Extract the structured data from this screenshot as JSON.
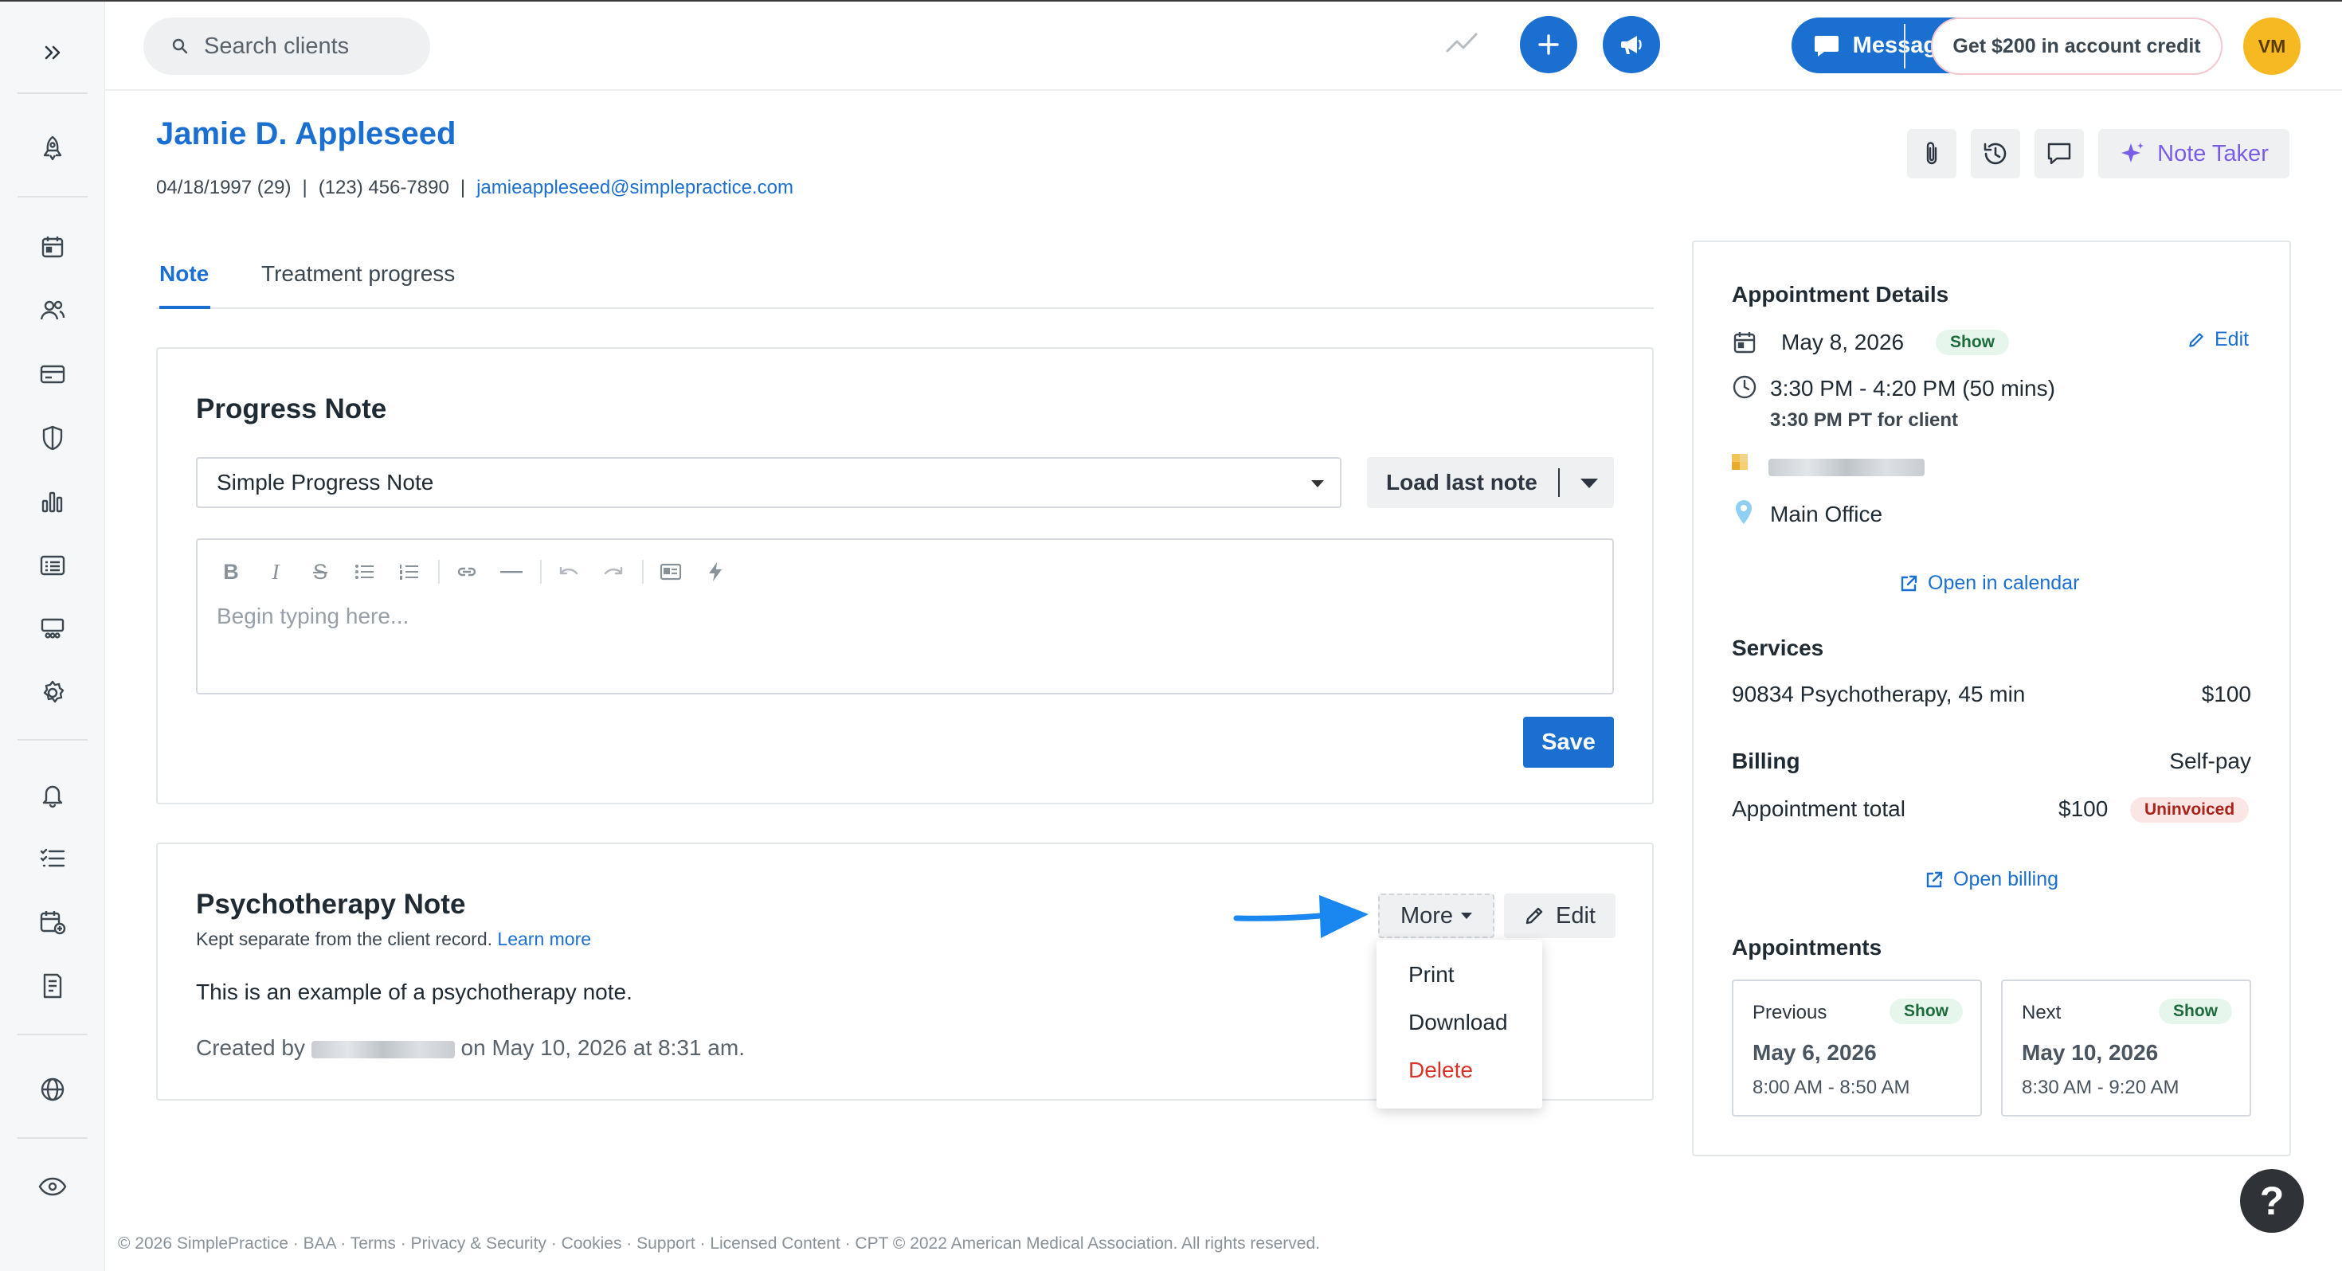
{
  "search": {
    "placeholder": "Search clients"
  },
  "topbar": {
    "messages_label": "Messages",
    "credit_label": "Get $200 in account credit",
    "avatar_initials": "VM"
  },
  "client": {
    "name": "Jamie D. Appleseed",
    "dob": "04/18/1997 (29)",
    "phone": "(123) 456-7890",
    "email": "jamieappleseed@simplepractice.com"
  },
  "header_actions": {
    "note_taker_label": "Note Taker"
  },
  "tabs": [
    {
      "label": "Note",
      "active": true
    },
    {
      "label": "Treatment progress",
      "active": false
    }
  ],
  "progress_note": {
    "title": "Progress Note",
    "template_selected": "Simple Progress Note",
    "load_last_label": "Load last note",
    "editor_placeholder": "Begin typing here...",
    "save_label": "Save"
  },
  "psychotherapy_note": {
    "title": "Psychotherapy Note",
    "subtitle": "Kept separate from the client record.",
    "learn_more": "Learn more",
    "more_label": "More",
    "edit_label": "Edit",
    "body": "This is an example of a psychotherapy note.",
    "created_prefix": "Created by",
    "created_suffix": "on May 10, 2026 at 8:31 am.",
    "menu": [
      "Print",
      "Download",
      "Delete"
    ]
  },
  "appointment": {
    "section_title": "Appointment Details",
    "edit_label": "Edit",
    "date": "May 8, 2026",
    "status": "Show",
    "time": "3:30 PM - 4:20 PM (50 mins)",
    "client_time": "3:30 PM PT for client",
    "location": "Main Office",
    "open_calendar": "Open in calendar",
    "services_title": "Services",
    "service_name": "90834 Psychotherapy, 45 min",
    "service_price": "$100",
    "billing_title": "Billing",
    "billing_type": "Self-pay",
    "total_label": "Appointment total",
    "total_value": "$100",
    "invoice_status": "Uninvoiced",
    "open_billing": "Open billing",
    "appointments_title": "Appointments",
    "previous": {
      "label": "Previous",
      "status": "Show",
      "date": "May 6, 2026",
      "time": "8:00 AM - 8:50 AM"
    },
    "next": {
      "label": "Next",
      "status": "Show",
      "date": "May 10, 2026",
      "time": "8:30 AM - 9:20 AM"
    }
  },
  "footer": {
    "text": "© 2026 SimplePractice · BAA · Terms · Privacy & Security · Cookies · Support · Licensed Content · CPT © 2022 American Medical Association. All rights reserved."
  },
  "help_label": "?",
  "colors": {
    "accent": "#1a6fd1",
    "note_taker": "#7a5ce6",
    "danger": "#d8342a",
    "avatar": "#f7b921"
  }
}
